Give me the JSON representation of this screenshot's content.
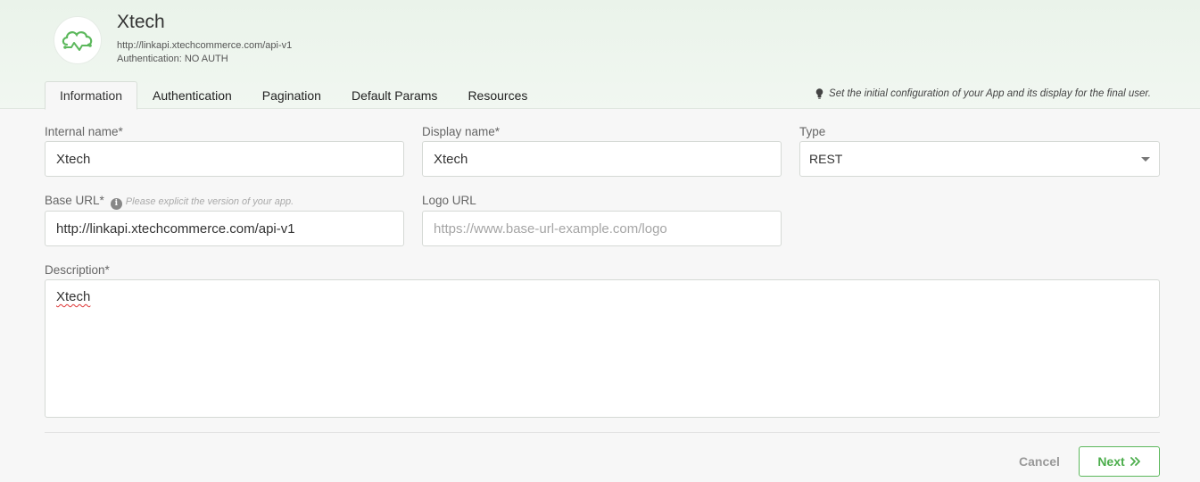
{
  "app": {
    "name": "Xtech",
    "url": "http://linkapi.xtechcommerce.com/api-v1",
    "auth": "Authentication: NO AUTH",
    "logo_icon": "cloud-network-icon",
    "accent_color": "#5cb85c"
  },
  "tabs": [
    {
      "label": "Information",
      "active": true
    },
    {
      "label": "Authentication",
      "active": false
    },
    {
      "label": "Pagination",
      "active": false
    },
    {
      "label": "Default Params",
      "active": false
    },
    {
      "label": "Resources",
      "active": false
    }
  ],
  "tab_hint": {
    "icon": "lightbulb-icon",
    "text": "Set the initial configuration of your App and its display for the final user."
  },
  "form": {
    "internal_name": {
      "label": "Internal name*",
      "value": "Xtech"
    },
    "display_name": {
      "label": "Display name*",
      "value": "Xtech"
    },
    "type": {
      "label": "Type",
      "value": "REST"
    },
    "base_url": {
      "label": "Base URL*",
      "hint": "Please explicit the version of your app.",
      "value": "http://linkapi.xtechcommerce.com/api-v1"
    },
    "logo_url": {
      "label": "Logo URL",
      "placeholder": "https://www.base-url-example.com/logo",
      "value": ""
    },
    "description": {
      "label": "Description*",
      "value": "Xtech"
    }
  },
  "actions": {
    "cancel": "Cancel",
    "next": "Next"
  }
}
